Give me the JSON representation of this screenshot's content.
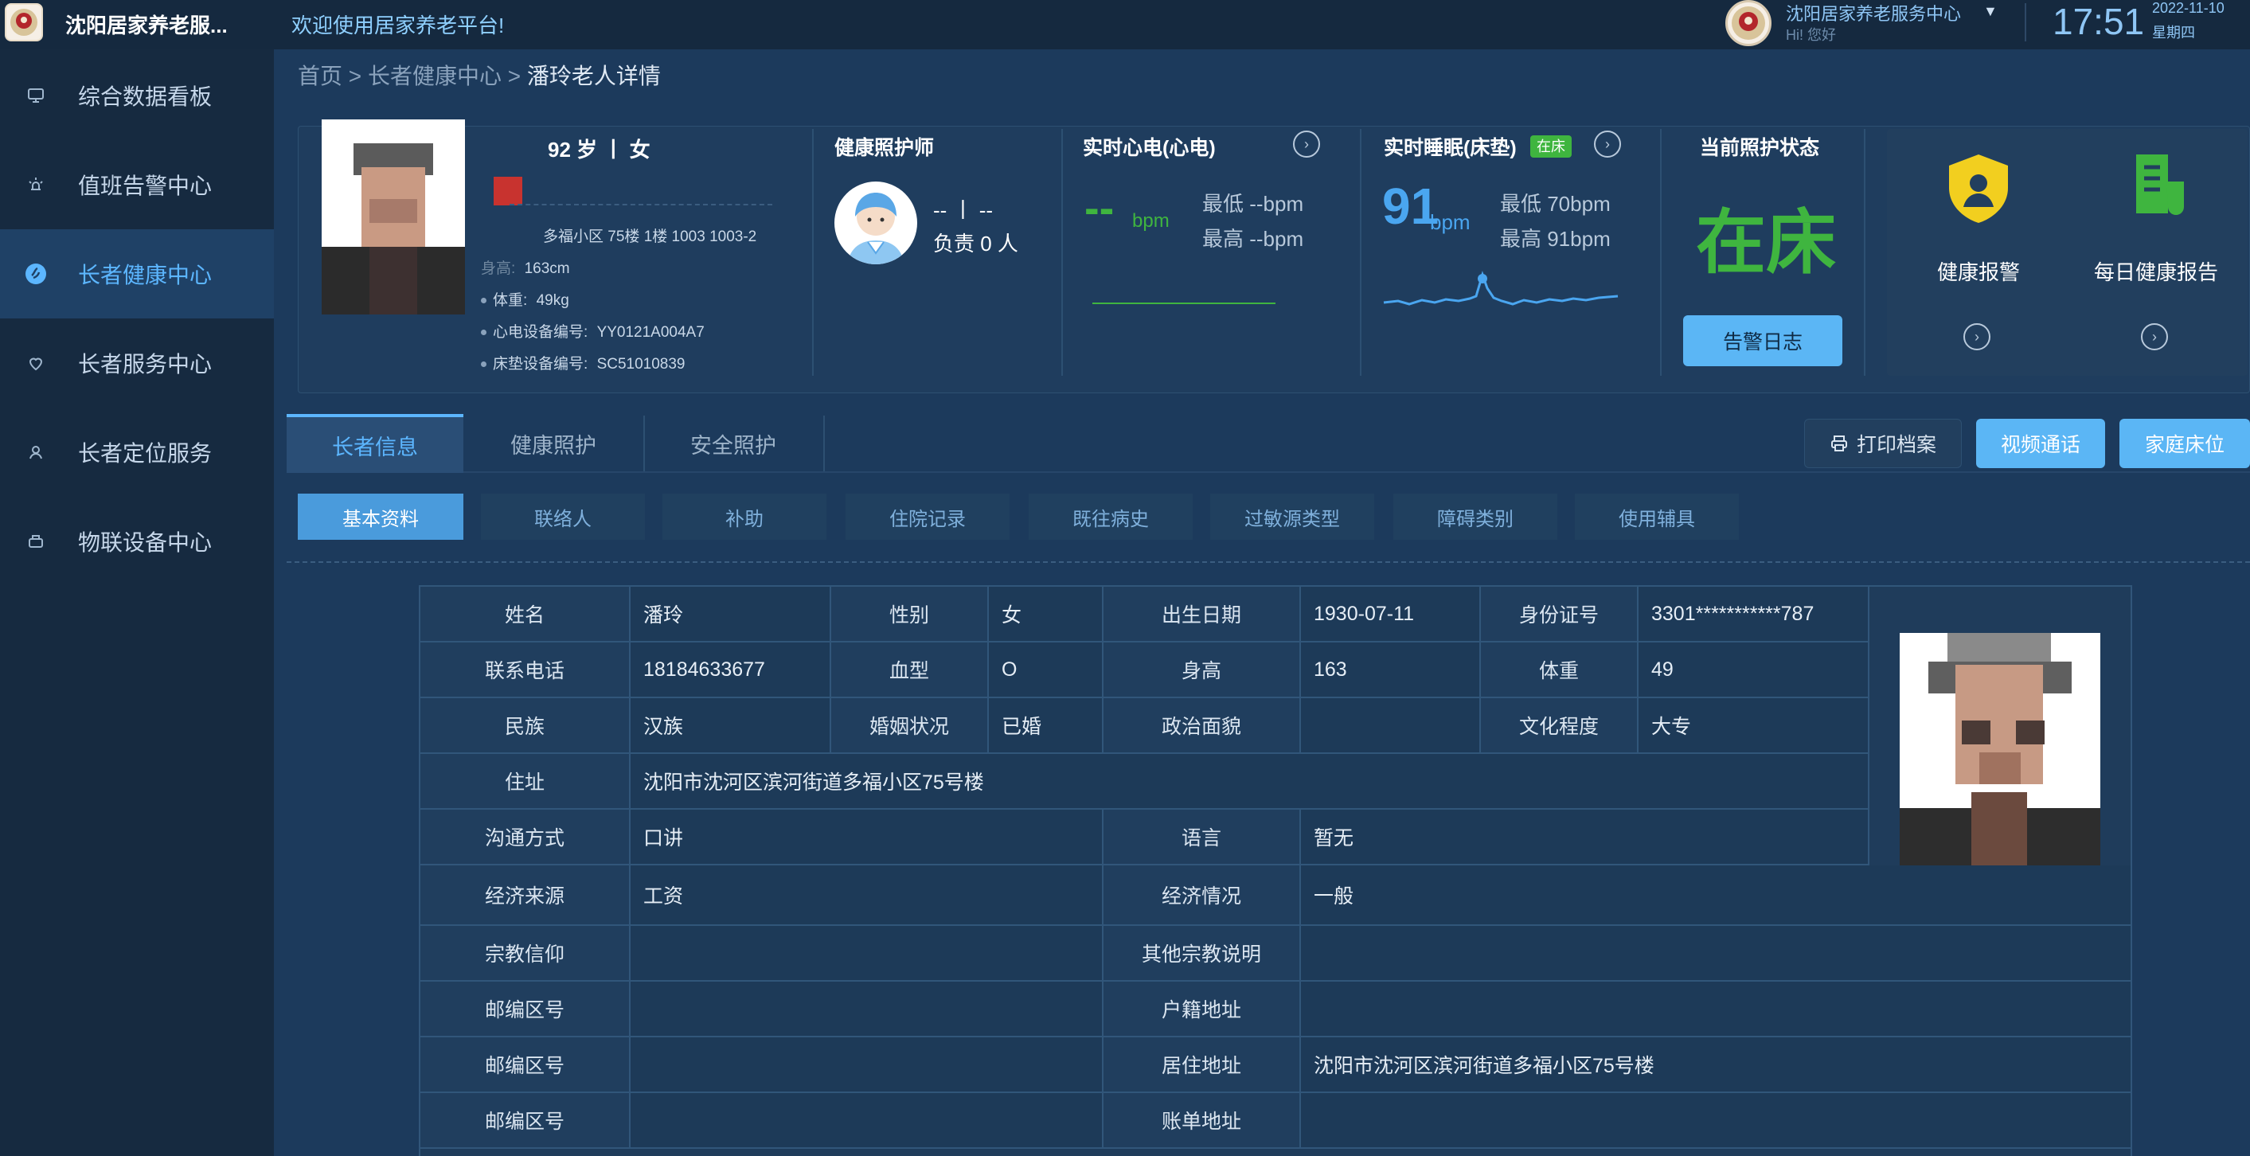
{
  "header": {
    "app_title": "沈阳居家养老服...",
    "welcome": "欢迎使用居家养老平台!",
    "org_name": "沈阳居家养老服务中心",
    "greeting": "Hi! 您好",
    "time": "17:51",
    "date": "2022-11-10",
    "weekday": "星期四"
  },
  "sidebar": {
    "items": [
      {
        "label": "综合数据看板",
        "icon": "monitor-icon"
      },
      {
        "label": "值班告警中心",
        "icon": "alarm-icon"
      },
      {
        "label": "长者健康中心",
        "icon": "health-icon",
        "active": true
      },
      {
        "label": "长者服务中心",
        "icon": "service-icon"
      },
      {
        "label": "长者定位服务",
        "icon": "location-person-icon"
      },
      {
        "label": "物联设备中心",
        "icon": "device-icon"
      }
    ]
  },
  "breadcrumb": {
    "home": "首页",
    "sep1": ">",
    "section": "长者健康中心",
    "sep2": ">",
    "current": "潘玲老人详情"
  },
  "profile": {
    "age_gender": "92 岁 丨 女",
    "address_short": "多福小区 75楼 1楼 1003 1003-2",
    "height": "163cm",
    "height_label": "身高:",
    "weight_label": "体重:",
    "weight": "49kg",
    "ecg_device_label": "心电设备编号:",
    "ecg_device": "YY0121A004A7",
    "mattress_device_label": "床垫设备编号:",
    "mattress_device": "SC51010839"
  },
  "caregiver": {
    "title": "健康照护师",
    "name": "-- 丨 --",
    "count_text": "负责 0 人"
  },
  "heart": {
    "title": "实时心电(心电)",
    "value": "--",
    "unit": "bpm",
    "min_text": "最低 --bpm",
    "max_text": "最高 --bpm"
  },
  "sleep": {
    "title": "实时睡眠(床垫)",
    "badge": "在床",
    "value": "91",
    "unit": "bpm",
    "min_text": "最低 70bpm",
    "max_text": "最高 91bpm"
  },
  "care_status": {
    "title": "当前照护状态",
    "status": "在床",
    "alert_log_btn": "告警日志"
  },
  "tiles": {
    "health_alert": "健康报警",
    "daily_report": "每日健康报告"
  },
  "main_tabs": [
    "长者信息",
    "健康照护",
    "安全照护"
  ],
  "actions": {
    "print": "打印档案",
    "video_call": "视频通话",
    "family_bed": "家庭床位"
  },
  "sub_tabs": [
    "基本资料",
    "联络人",
    "补助",
    "住院记录",
    "既往病史",
    "过敏源类型",
    "障碍类别",
    "使用辅具"
  ],
  "basic_info": {
    "name_k": "姓名",
    "name_v": "潘玲",
    "gender_k": "性别",
    "gender_v": "女",
    "birth_k": "出生日期",
    "birth_v": "1930-07-11",
    "id_k": "身份证号",
    "id_v": "3301***********787",
    "phone_k": "联系电话",
    "phone_v": "18184633677",
    "blood_k": "血型",
    "blood_v": "O",
    "height_k": "身高",
    "height_v": "163",
    "weight_k": "体重",
    "weight_v": "49",
    "ethnic_k": "民族",
    "ethnic_v": "汉族",
    "marital_k": "婚姻状况",
    "marital_v": "已婚",
    "political_k": "政治面貌",
    "political_v": "",
    "edu_k": "文化程度",
    "edu_v": "大专",
    "address_k": "住址",
    "address_v": "沈阳市沈河区滨河街道多福小区75号楼",
    "comm_k": "沟通方式",
    "comm_v": "口讲",
    "lang_k": "语言",
    "lang_v": "暂无",
    "income_k": "经济来源",
    "income_v": "工资",
    "econ_k": "经济情况",
    "econ_v": "一般",
    "religion_k": "宗教信仰",
    "religion_v": "",
    "other_religion_k": "其他宗教说明",
    "other_religion_v": "",
    "zip1_k": "邮编区号",
    "zip1_v": "",
    "hukou_k": "户籍地址",
    "hukou_v": "",
    "zip2_k": "邮编区号",
    "zip2_v": "",
    "residence_k": "居住地址",
    "residence_v": "沈阳市沈河区滨河街道多福小区75号楼",
    "zip3_k": "邮编区号",
    "zip3_v": "",
    "billing_k": "账单地址",
    "billing_v": ""
  },
  "colors": {
    "accent": "#5cb6ff",
    "status_green": "#3fb53f",
    "panel": "#1f3d5e",
    "background": "#1c3a5c"
  }
}
